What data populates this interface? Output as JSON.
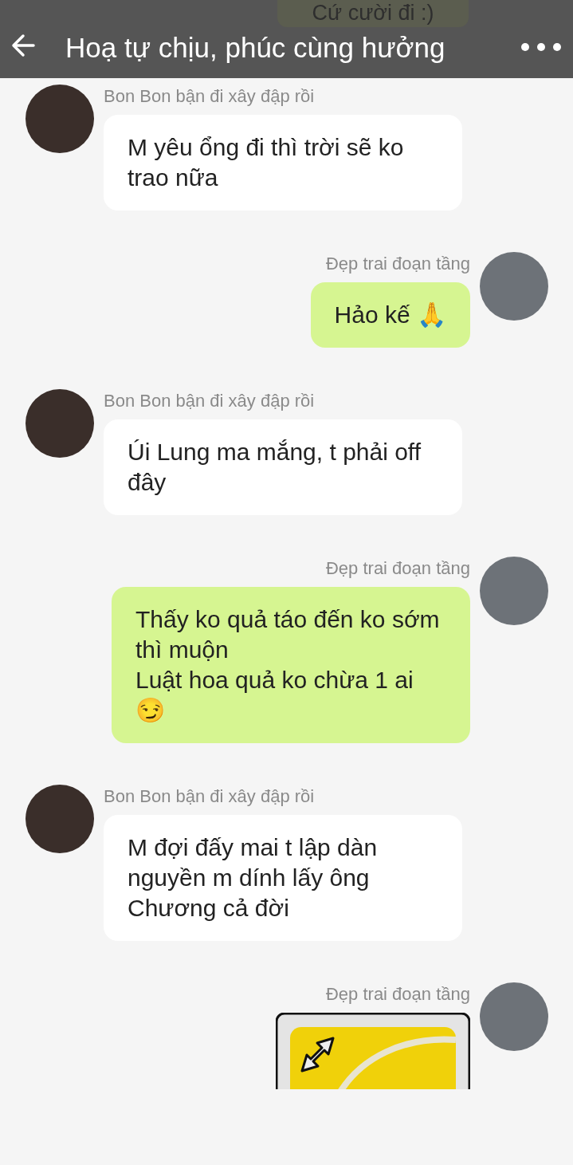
{
  "header": {
    "peek_message": "Cứ cười đi :)",
    "title": "Hoạ tự chịu, phúc cùng hưởng"
  },
  "messages": [
    {
      "kind": "text",
      "sent": false,
      "sender": "Bon Bon bận đi xây đập rồi",
      "text": "M yêu ổng đi thì trời sẽ ko trao nữa"
    },
    {
      "kind": "text",
      "sent": true,
      "sender": "Đẹp trai đoạn tầng",
      "text": "Hảo kế 🙏"
    },
    {
      "kind": "text",
      "sent": false,
      "sender": "Bon Bon bận đi xây đập rồi",
      "text": "Úi Lung ma mắng, t phải off đây"
    },
    {
      "kind": "text",
      "sent": true,
      "sender": "Đẹp trai đoạn tầng",
      "text": "Thấy ko quả táo đến ko sớm thì muộn\nLuật hoa quả ko chừa 1 ai\n😏"
    },
    {
      "kind": "text",
      "sent": false,
      "sender": "Bon Bon bận đi xây đập rồi",
      "text": "M đợi đấy mai t lập dàn nguyền m dính lấy ông Chương cả đời"
    },
    {
      "kind": "image",
      "sent": true,
      "sender": "Đẹp trai đoạn tầng"
    }
  ]
}
